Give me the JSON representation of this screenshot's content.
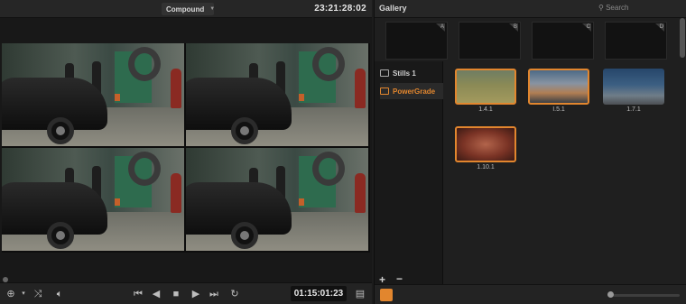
{
  "viewer": {
    "clip_selector": "Compound",
    "source_timecode": "23:21:28:02",
    "record_timecode": "01:15:01:23"
  },
  "gallery": {
    "title": "Gallery",
    "search_placeholder": "Search",
    "memory_slots": [
      "A",
      "B",
      "C",
      "D"
    ],
    "albums": [
      {
        "label": "Stills 1",
        "active": false
      },
      {
        "label": "PowerGrade",
        "active": true
      }
    ],
    "album_add_label": "+",
    "album_remove_label": "−",
    "stills": [
      {
        "label": "1.4.1",
        "selected": true
      },
      {
        "label": "I.5.1",
        "selected": true
      },
      {
        "label": "1.7.1",
        "selected": false
      },
      {
        "label": "1.10.1",
        "selected": true
      }
    ]
  },
  "colors": {
    "accent": "#e2862e",
    "panel": "#1f1f1f",
    "header": "#262626"
  },
  "icons": {
    "transport": [
      "first-frame-icon",
      "step-back-icon",
      "stop-icon",
      "play-icon",
      "last-frame-icon",
      "loop-icon"
    ],
    "left_tools": [
      "pointer-tool-icon",
      "shuffle-icon",
      "speaker-icon"
    ]
  }
}
